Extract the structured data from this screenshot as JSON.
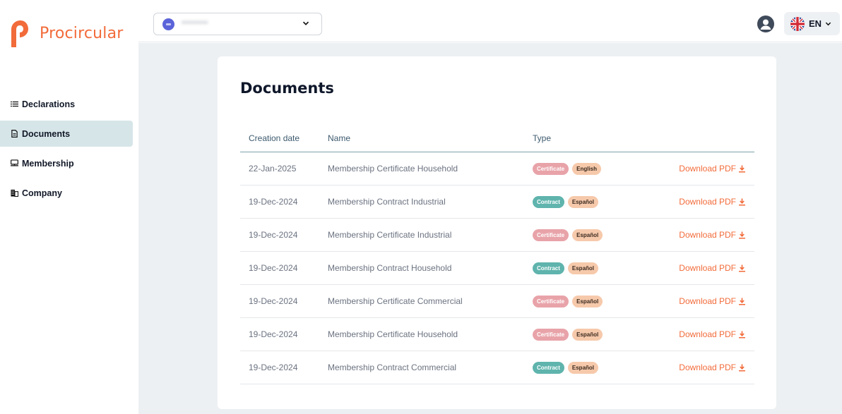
{
  "app": {
    "logo_text": "Procircular"
  },
  "sidebar": {
    "items": [
      {
        "label": "Declarations",
        "icon": "list-icon",
        "active": false
      },
      {
        "label": "Documents",
        "icon": "document-icon",
        "active": true
      },
      {
        "label": "Membership",
        "icon": "membership-icon",
        "active": false
      },
      {
        "label": "Company",
        "icon": "building-icon",
        "active": false
      }
    ]
  },
  "header": {
    "org_name": "********",
    "language": "EN"
  },
  "page": {
    "title": "Documents",
    "columns": [
      "Creation date",
      "Name",
      "Type",
      ""
    ],
    "rows": [
      {
        "date": "22-Jan-2025",
        "name": "Membership Certificate Household",
        "type": "Certificate",
        "lang": "English",
        "action": "Download PDF"
      },
      {
        "date": "19-Dec-2024",
        "name": "Membership Contract Industrial",
        "type": "Contract",
        "lang": "Español",
        "action": "Download PDF"
      },
      {
        "date": "19-Dec-2024",
        "name": "Membership Certificate Industrial",
        "type": "Certificate",
        "lang": "Español",
        "action": "Download PDF"
      },
      {
        "date": "19-Dec-2024",
        "name": "Membership Contract Household",
        "type": "Contract",
        "lang": "Español",
        "action": "Download PDF"
      },
      {
        "date": "19-Dec-2024",
        "name": "Membership Certificate Commercial",
        "type": "Certificate",
        "lang": "Español",
        "action": "Download PDF"
      },
      {
        "date": "19-Dec-2024",
        "name": "Membership Certificate Household",
        "type": "Certificate",
        "lang": "Español",
        "action": "Download PDF"
      },
      {
        "date": "19-Dec-2024",
        "name": "Membership Contract Commercial",
        "type": "Contract",
        "lang": "Español",
        "action": "Download PDF"
      }
    ]
  },
  "colors": {
    "brand": "#f26b3a",
    "active_nav": "#d6e5e8",
    "certificate_tag": "#e8a3a9",
    "contract_tag": "#5fb4ad",
    "language_tag": "#f6c9ab",
    "background": "#edf0f2"
  }
}
